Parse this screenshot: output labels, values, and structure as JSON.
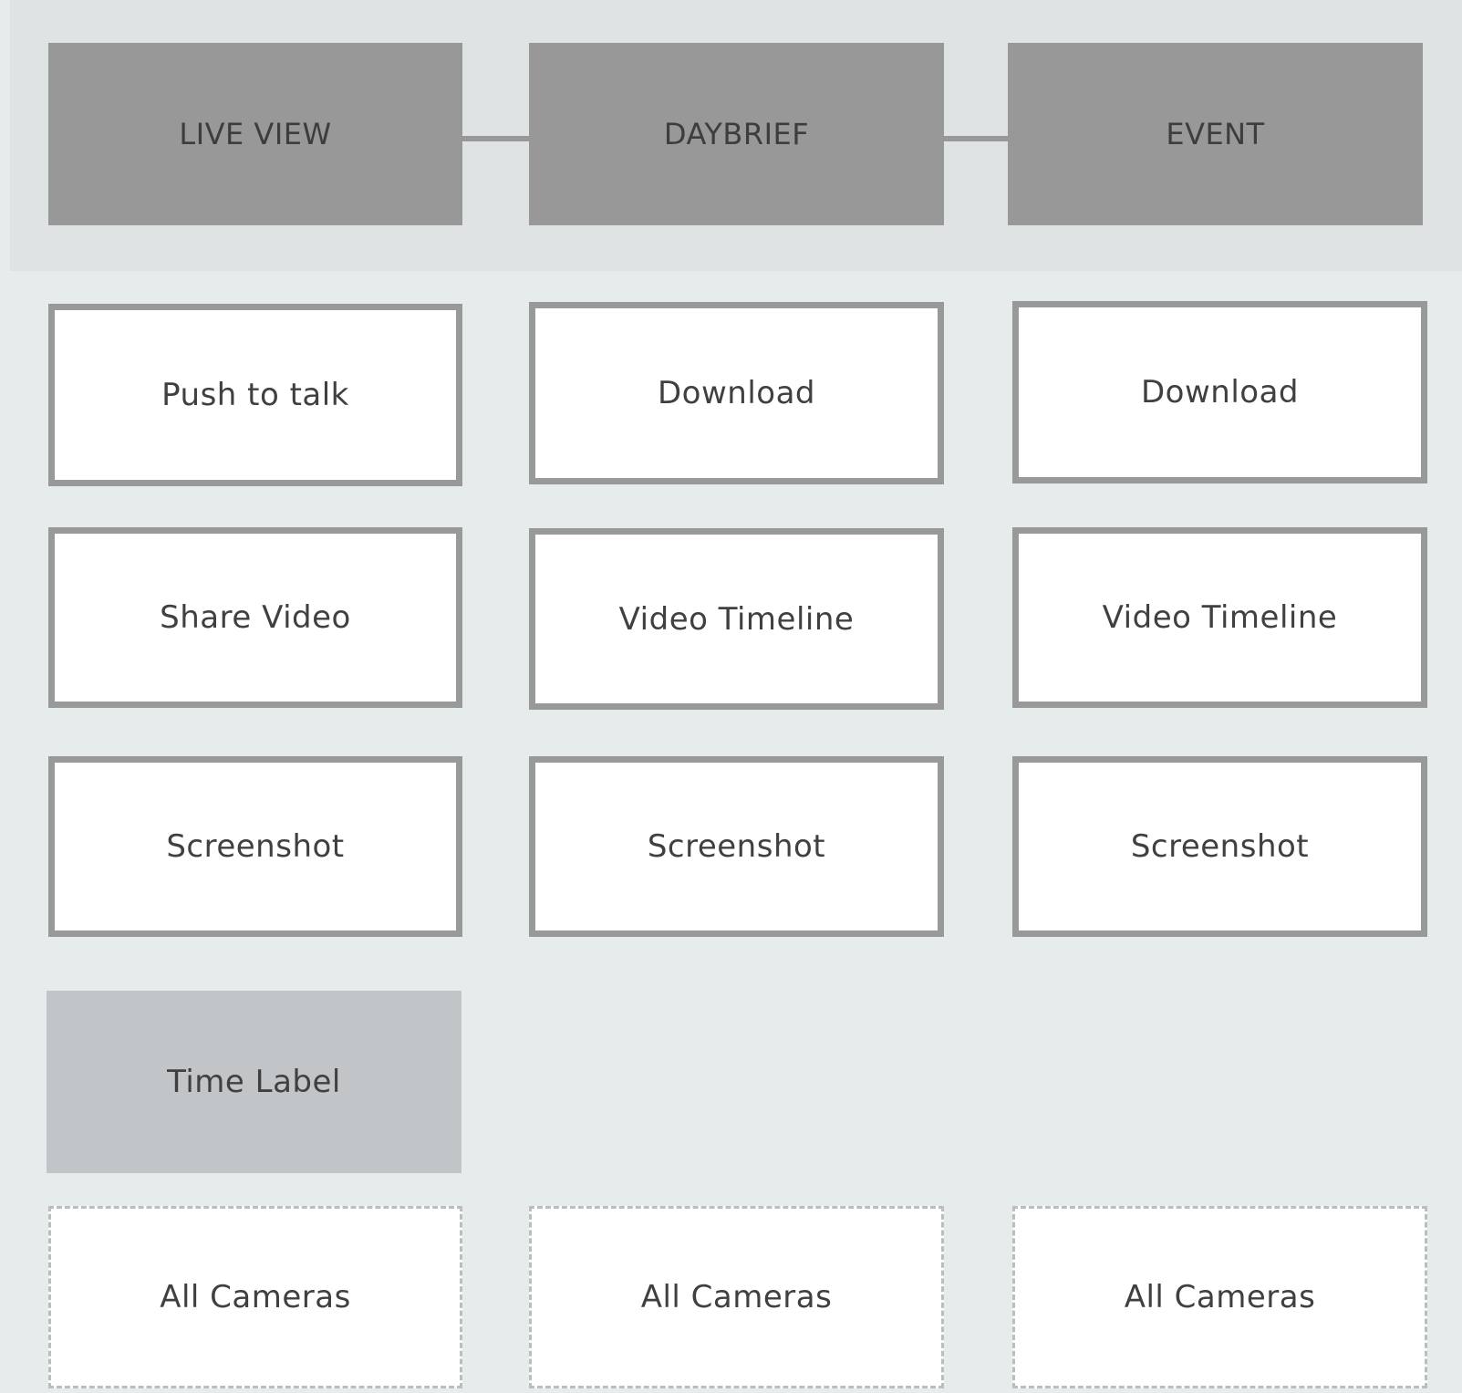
{
  "columns": [
    {
      "header": "LIVE VIEW"
    },
    {
      "header": "DAYBRIEF"
    },
    {
      "header": "EVENT"
    }
  ],
  "features": {
    "row1": [
      "Push to talk",
      "Download",
      "Download"
    ],
    "row2": [
      "Share Video",
      "Video Timeline",
      "Video Timeline"
    ],
    "row3": [
      "Screenshot",
      "Screenshot",
      "Screenshot"
    ]
  },
  "time_label": "Time Label",
  "cameras": [
    "All Cameras",
    "All Cameras",
    "All Cameras"
  ],
  "colors": {
    "background": "#e6ebeb",
    "header_band": "#dfe3e3",
    "header_box": "#989898",
    "feature_border": "#999999",
    "feature_fill": "#ffffff",
    "time_label_fill": "#c1c5c8",
    "dashed_border": "#bdbdbd",
    "text": "#404040"
  }
}
